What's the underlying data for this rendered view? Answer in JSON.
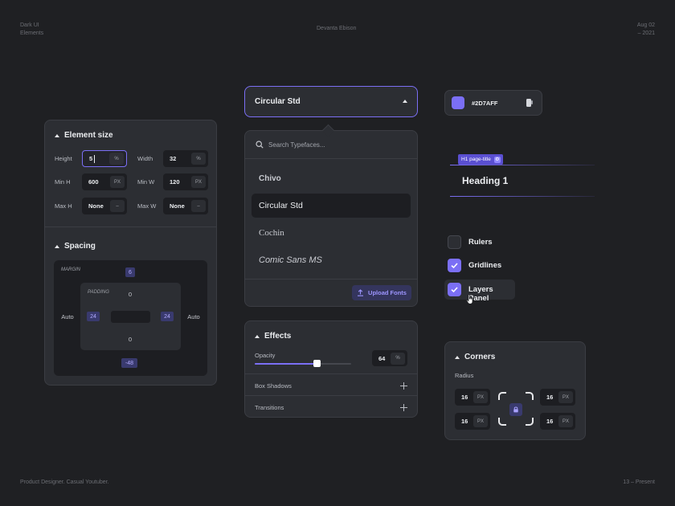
{
  "meta": {
    "top_left": [
      "Dark UI",
      "Elements"
    ],
    "top_center": "Devanta Ebison",
    "top_right": [
      "Aug 02",
      "– 2021"
    ],
    "bottom_left": "Product Designer. Casual Youtuber.",
    "bottom_right": "13 – Present"
  },
  "element_size": {
    "title": "Element size",
    "height_label": "Height",
    "height_value": "5",
    "height_unit": "%",
    "width_label": "Width",
    "width_value": "32",
    "width_unit": "%",
    "minh_label": "Min H",
    "minh_value": "600",
    "minh_unit": "PX",
    "minw_label": "Min W",
    "minw_value": "120",
    "minw_unit": "PX",
    "maxh_label": "Max H",
    "maxh_value": "None",
    "maxh_unit": "–",
    "maxw_label": "Max W",
    "maxw_value": "None",
    "maxw_unit": "–"
  },
  "spacing": {
    "title": "Spacing",
    "margin_label": "MARGIN",
    "margin_top": "6",
    "margin_left": "Auto",
    "margin_right": "Auto",
    "margin_bottom": "-48",
    "padding_label": "PADDING",
    "padding_top": "0",
    "padding_left": "24",
    "padding_right": "24",
    "padding_bottom": "0"
  },
  "font_select": {
    "selected": "Circular Std",
    "search_placeholder": "Search Typefaces...",
    "fonts": [
      "Chivo",
      "Circular Std",
      "Cochin",
      "Comic Sans MS"
    ],
    "upload_label": "Upload Fonts"
  },
  "effects": {
    "title": "Effects",
    "opacity_label": "Opacity",
    "opacity_value": "64",
    "opacity_unit": "%",
    "opacity_level": 0.64,
    "box_shadows_label": "Box Shadows",
    "transitions_label": "Transitions"
  },
  "color": {
    "hex_label": "#2D7AFF",
    "swatch": "#7b6ff5"
  },
  "heading_tag": {
    "tag_label": "H1 page-title",
    "heading_text": "Heading 1"
  },
  "checks": [
    {
      "label": "Rulers",
      "checked": false
    },
    {
      "label": "Gridlines",
      "checked": true
    },
    {
      "label": "Layers Panel",
      "checked": true
    }
  ],
  "corners": {
    "title": "Corners",
    "radius_label": "Radius",
    "tl_value": "16",
    "tr_value": "16",
    "bl_value": "16",
    "br_value": "16",
    "unit": "PX"
  },
  "colors": {
    "accent": "#7b6ff5",
    "background": "#1f2023",
    "panel": "#2c2e33"
  }
}
